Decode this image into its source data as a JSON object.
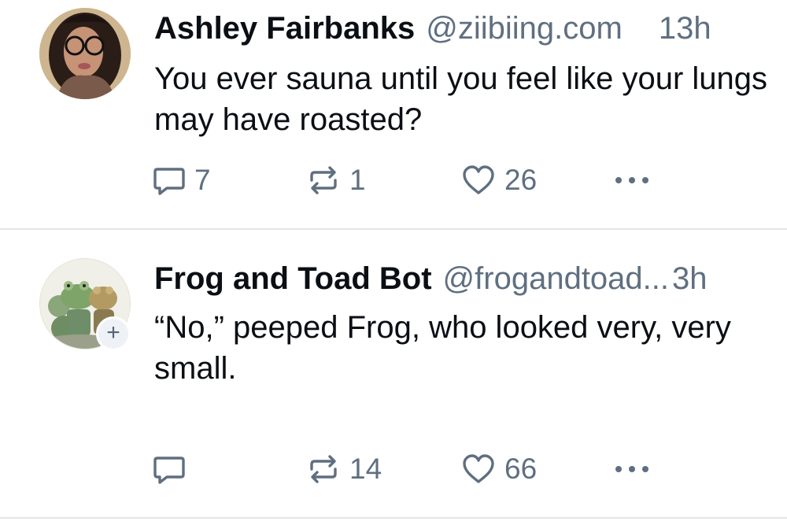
{
  "posts": [
    {
      "author": "Ashley Fairbanks",
      "handle": "@ziibiing.com",
      "time": "13h",
      "text": "You ever sauna until you feel like your lungs may have roasted?",
      "replies": "7",
      "reposts": "1",
      "likes": "26"
    },
    {
      "author": "Frog and Toad Bot",
      "handle": "@frogandtoad...",
      "time": "3h",
      "text": "“No,” peeped Frog, who looked very, very small.",
      "replies": "",
      "reposts": "14",
      "likes": "66",
      "follow_badge": "+"
    }
  ],
  "icons": {
    "reply": "speech-bubble-icon",
    "repost": "repost-arrows-icon",
    "like": "heart-icon",
    "more": "ellipsis-icon"
  },
  "colors": {
    "text": "#0b0f14",
    "muted": "#5f6f80",
    "divider": "#e2e6eb"
  }
}
